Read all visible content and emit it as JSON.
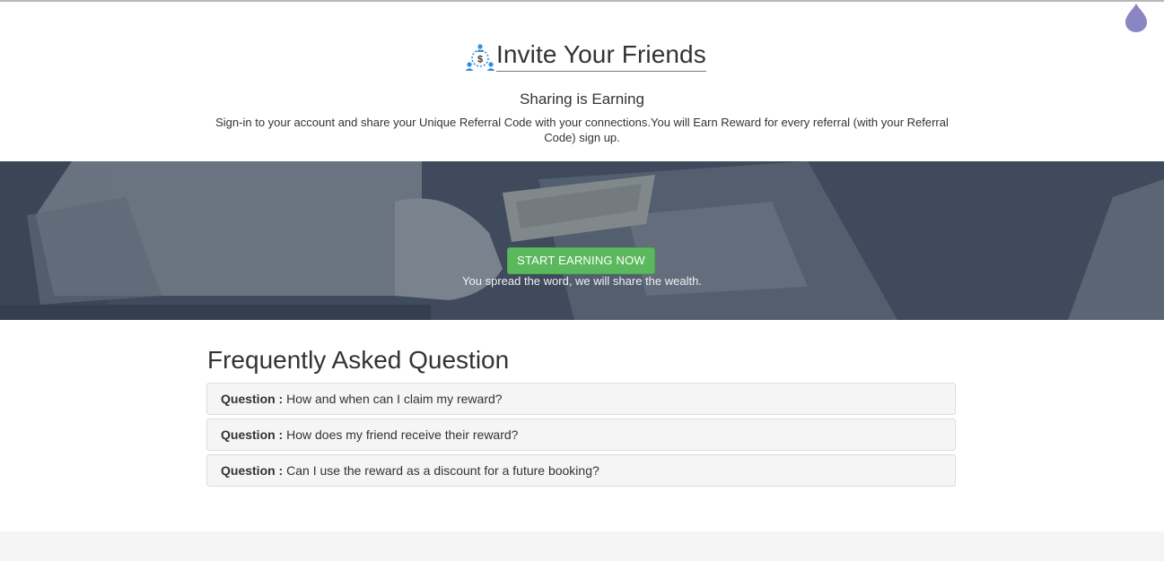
{
  "header": {
    "title": "Invite Your Friends",
    "title_icon": "referral-network-icon",
    "theme_icon": "drop-icon"
  },
  "intro": {
    "subtitle": "Sharing is Earning",
    "description": "Sign-in to your account and share your Unique Referral Code with your connections.You will Earn Reward for every referral (with your Referral Code) sign up."
  },
  "banner": {
    "cta_label": "START EARNING NOW",
    "tagline": "You spread the word, we will share the wealth."
  },
  "faq": {
    "title": "Frequently Asked Question",
    "items": [
      {
        "prefix": "Question :",
        "text": "How and when can I claim my reward?"
      },
      {
        "prefix": "Question :",
        "text": "How does my friend receive their reward?"
      },
      {
        "prefix": "Question :",
        "text": "Can I use the reward as a discount for a future booking?"
      }
    ]
  },
  "colors": {
    "cta": "#5cb85c",
    "banner_overlay": "#3f4b5d",
    "icon_blue": "#2e8fe0",
    "drop_purple": "#8a86c3"
  }
}
